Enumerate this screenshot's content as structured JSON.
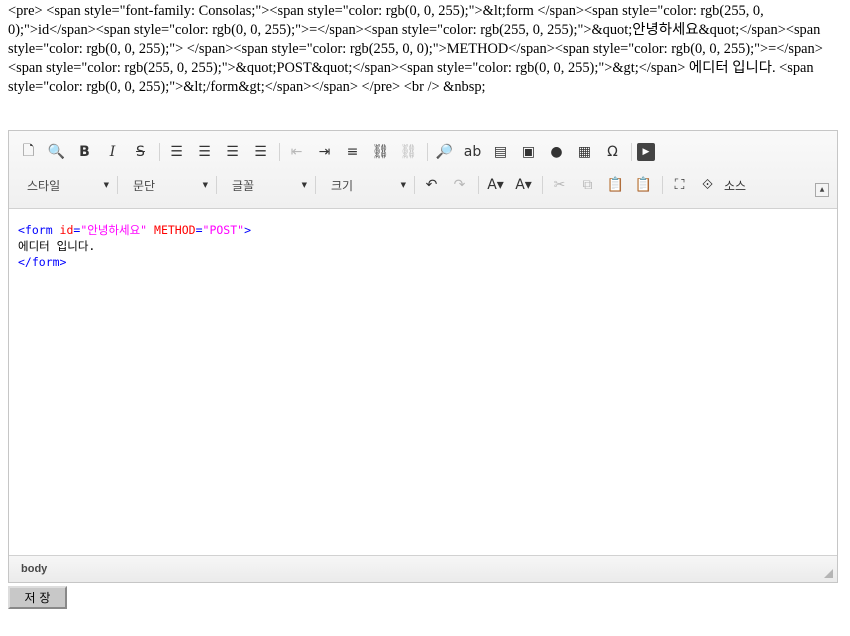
{
  "page": {
    "source_text": "<pre> <span style=\"font-family: Consolas;\"><span style=\"color: rgb(0, 0, 255);\">&lt;form </span><span style=\"color: rgb(255, 0, 0);\">id</span><span style=\"color: rgb(0, 0, 255);\">=</span><span style=\"color: rgb(255, 0, 255);\">&quot;안녕하세요&quot;</span><span style=\"color: rgb(0, 0, 255);\"> </span><span style=\"color: rgb(255, 0, 0);\">METHOD</span><span style=\"color: rgb(0, 0, 255);\">=</span><span style=\"color: rgb(255, 0, 255);\">&quot;POST&quot;</span><span style=\"color: rgb(0, 0, 255);\">&gt;</span> 에디터 입니다. <span style=\"color: rgb(0, 0, 255);\">&lt;/form&gt;</span></span> </pre> <br /> &nbsp;"
  },
  "toolbar": {
    "row1_icons": [
      {
        "name": "new-page-icon",
        "glyph": "🗋",
        "enabled": true
      },
      {
        "name": "preview-icon",
        "glyph": "🔍",
        "enabled": true
      },
      {
        "name": "bold-icon",
        "glyph": "B",
        "enabled": true
      },
      {
        "name": "italic-icon",
        "glyph": "I",
        "enabled": true
      },
      {
        "name": "strikethrough-icon",
        "glyph": "S",
        "enabled": true
      },
      {
        "name": "sep"
      },
      {
        "name": "align-left-icon",
        "glyph": "☰",
        "enabled": true
      },
      {
        "name": "align-center-icon",
        "glyph": "☰",
        "enabled": true
      },
      {
        "name": "align-right-icon",
        "glyph": "☰",
        "enabled": true
      },
      {
        "name": "align-justify-icon",
        "glyph": "☰",
        "enabled": true
      },
      {
        "name": "sep"
      },
      {
        "name": "outdent-icon",
        "glyph": "⇤",
        "enabled": false
      },
      {
        "name": "indent-icon",
        "glyph": "⇥",
        "enabled": true
      },
      {
        "name": "blockquote-icon",
        "glyph": "≡",
        "enabled": true
      },
      {
        "name": "link-icon",
        "glyph": "⛓",
        "enabled": true
      },
      {
        "name": "unlink-icon",
        "glyph": "⛓",
        "enabled": false
      },
      {
        "name": "sep"
      },
      {
        "name": "find-icon",
        "glyph": "🔎",
        "enabled": true
      },
      {
        "name": "replace-icon",
        "glyph": "ab",
        "enabled": true
      },
      {
        "name": "select-all-icon",
        "glyph": "▤",
        "enabled": true
      },
      {
        "name": "image-icon",
        "glyph": "▣",
        "enabled": true
      },
      {
        "name": "flash-icon",
        "glyph": "●",
        "enabled": true
      },
      {
        "name": "table-icon",
        "glyph": "▦",
        "enabled": true
      },
      {
        "name": "special-char-icon",
        "glyph": "Ω",
        "enabled": true
      },
      {
        "name": "sep"
      },
      {
        "name": "youtube-icon",
        "glyph": "▶",
        "enabled": true
      }
    ],
    "style_label": "스타일",
    "format_label": "문단",
    "font_label": "글꼴",
    "size_label": "크기",
    "row2_icons": [
      {
        "name": "undo-icon",
        "glyph": "↶",
        "enabled": true
      },
      {
        "name": "redo-icon",
        "glyph": "↷",
        "enabled": false
      },
      {
        "name": "sep"
      },
      {
        "name": "text-color-icon",
        "glyph": "A▾",
        "enabled": true
      },
      {
        "name": "bg-color-icon",
        "glyph": "A▾",
        "enabled": true
      },
      {
        "name": "sep"
      },
      {
        "name": "cut-icon",
        "glyph": "✂",
        "enabled": false
      },
      {
        "name": "copy-icon",
        "glyph": "⧉",
        "enabled": false
      },
      {
        "name": "paste-icon",
        "glyph": "📋",
        "enabled": true
      },
      {
        "name": "paste-text-icon",
        "glyph": "📋",
        "enabled": true
      },
      {
        "name": "sep"
      },
      {
        "name": "maximize-icon",
        "glyph": "⛶",
        "enabled": true
      },
      {
        "name": "source-icon",
        "glyph": "⟐",
        "enabled": true
      }
    ],
    "source_label": "소스"
  },
  "content": {
    "open_tag_start": "<form ",
    "attr_id": "id",
    "equals": "=",
    "value_id": "\"안녕하세요\"",
    "space": " ",
    "attr_method": "METHOD",
    "value_method": "\"POST\"",
    "tag_close": ">",
    "body_text": "에디터 입니다.",
    "close_tag": "</form>"
  },
  "statusbar": {
    "path": "body"
  },
  "save_button_label": "저 장",
  "colors": {
    "tag": "#0000ff",
    "attribute": "#ff0000",
    "value": "#ff00ff"
  }
}
